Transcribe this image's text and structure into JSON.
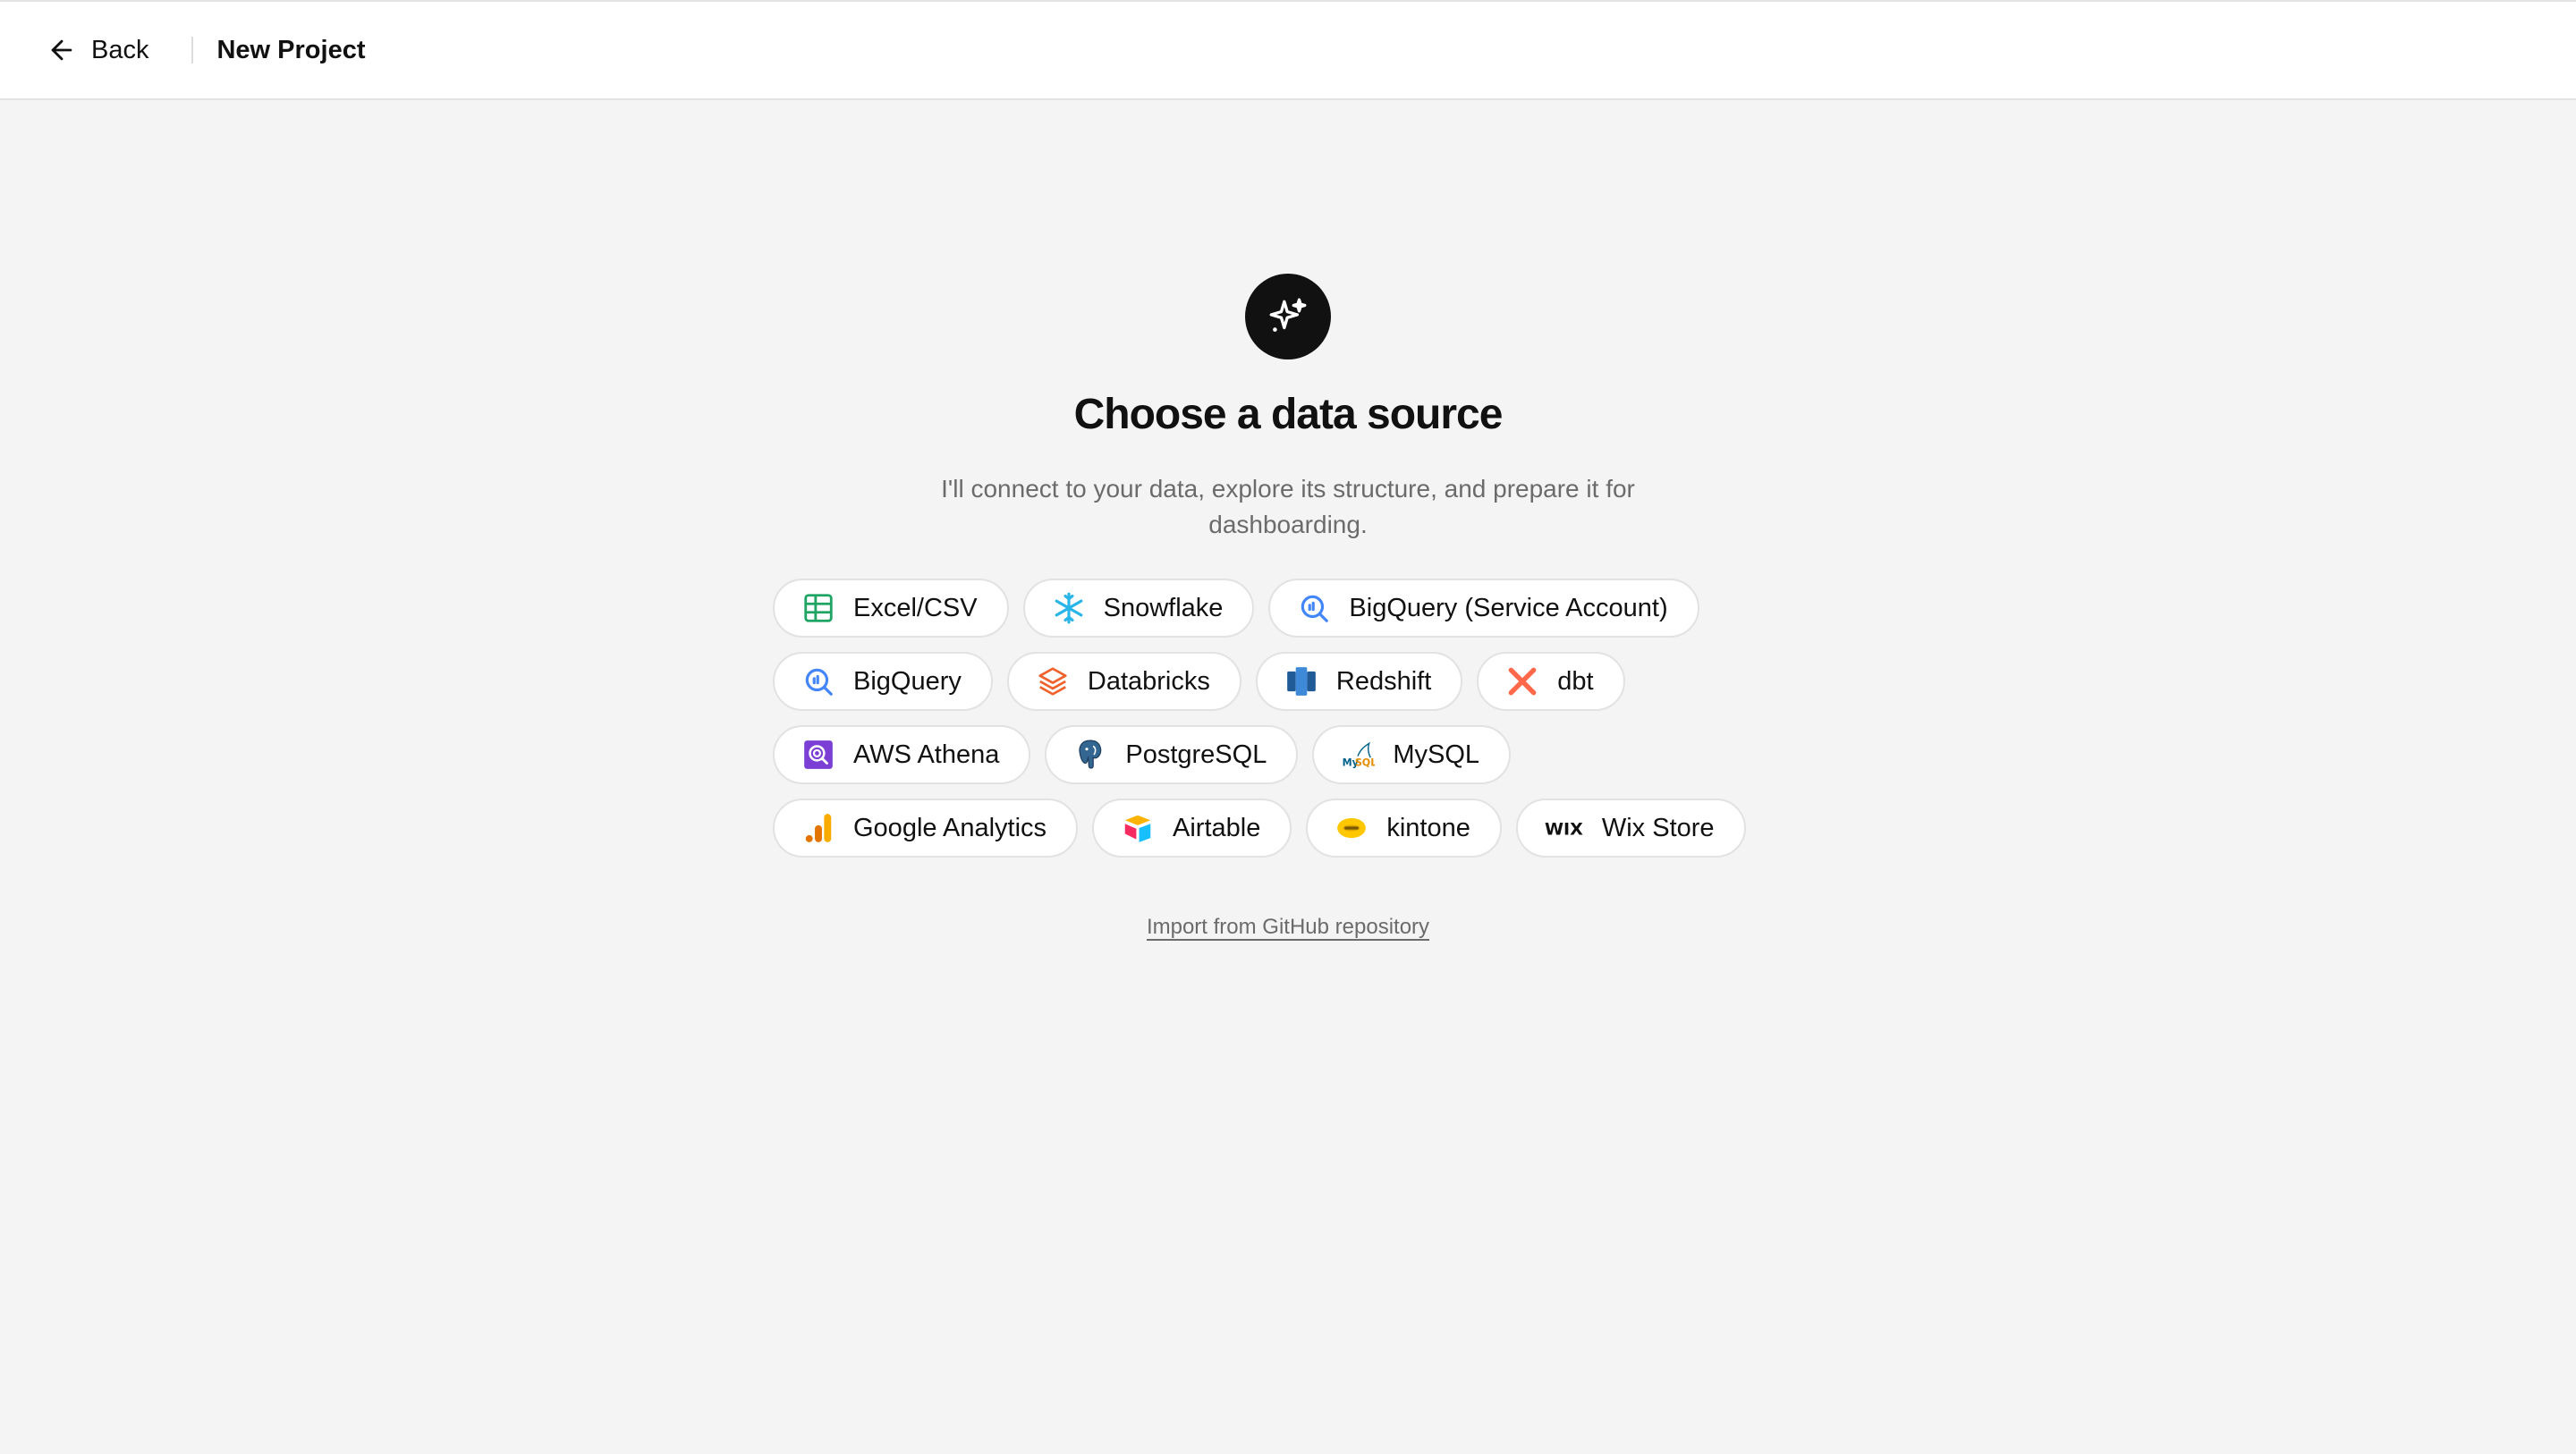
{
  "header": {
    "back_label": "Back",
    "page_title": "New Project"
  },
  "main": {
    "heading": "Choose a data source",
    "subtitle": "I'll connect to your data, explore its structure, and prepare it for dashboarding.",
    "github_link": "Import from GitHub repository"
  },
  "sources": [
    {
      "label": "Excel/CSV",
      "icon": "spreadsheet-icon"
    },
    {
      "label": "Snowflake",
      "icon": "snowflake-icon"
    },
    {
      "label": "BigQuery (Service Account)",
      "icon": "bigquery-icon"
    },
    {
      "label": "BigQuery",
      "icon": "bigquery-icon"
    },
    {
      "label": "Databricks",
      "icon": "databricks-icon"
    },
    {
      "label": "Redshift",
      "icon": "redshift-icon"
    },
    {
      "label": "dbt",
      "icon": "dbt-icon"
    },
    {
      "label": "AWS Athena",
      "icon": "athena-icon"
    },
    {
      "label": "PostgreSQL",
      "icon": "postgresql-icon"
    },
    {
      "label": "MySQL",
      "icon": "mysql-icon"
    },
    {
      "label": "Google Analytics",
      "icon": "google-analytics-icon"
    },
    {
      "label": "Airtable",
      "icon": "airtable-icon"
    },
    {
      "label": "kintone",
      "icon": "kintone-icon"
    },
    {
      "label": "Wix Store",
      "icon": "wix-icon",
      "icon_text": "WIX"
    }
  ],
  "colors": {
    "background": "#f4f4f4",
    "accent": "#111111",
    "muted_text": "#6b6b6b"
  }
}
